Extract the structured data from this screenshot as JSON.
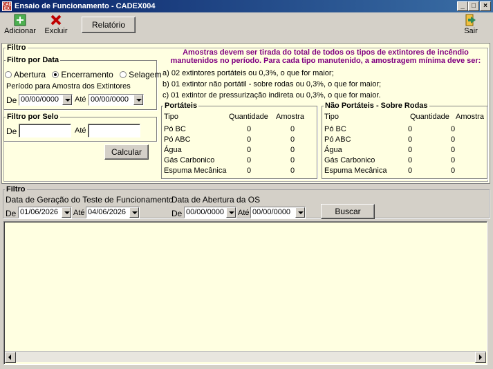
{
  "window": {
    "title": "Ensaio de Funcionamento - CADEX004",
    "app_icon_text": "CAD EX"
  },
  "toolbar": {
    "add_label": "Adicionar",
    "delete_label": "Excluir",
    "report_label": "Relatório",
    "exit_label": "Sair"
  },
  "filter1": {
    "legend": "Filtro",
    "date_filter": {
      "legend": "Filtro por Data",
      "radios": [
        {
          "label": "Abertura",
          "checked": false
        },
        {
          "label": "Encerramento",
          "checked": true
        },
        {
          "label": "Selagem",
          "checked": false
        }
      ],
      "period_label": "Período para Amostra dos Extintores",
      "from_label": "De",
      "from_value": "00/00/0000",
      "to_label": "Até",
      "to_value": "00/00/0000"
    },
    "seal_filter": {
      "legend": "Filtro por Selo",
      "from_label": "De",
      "to_label": "Até",
      "from_value": "",
      "to_value": ""
    },
    "calc_label": "Calcular",
    "notice": "Amostras devem ser tirada do total de todos os tipos de extintores de incêndio manutenidos no período. Para cada tipo manutenido, a amostragem mínima deve ser:",
    "rules": [
      "a) 02 extintores portáteis ou 0,3%, o que for maior;",
      "b) 01 extintor não portátil - sobre rodas ou 0,3%, o que for maior;",
      "c) 01 extintor de pressurização indireta ou 0,3%, o que for maior."
    ],
    "portable": {
      "legend": "Portáteis",
      "headers": [
        "Tipo",
        "Quantidade",
        "Amostra"
      ],
      "rows": [
        {
          "tipo": "Pó BC",
          "qtd": "0",
          "amostra": "0"
        },
        {
          "tipo": "Pó ABC",
          "qtd": "0",
          "amostra": "0"
        },
        {
          "tipo": "Água",
          "qtd": "0",
          "amostra": "0"
        },
        {
          "tipo": "Gás Carbonico",
          "qtd": "0",
          "amostra": "0"
        },
        {
          "tipo": "Espuma Mecânica",
          "qtd": "0",
          "amostra": "0"
        }
      ]
    },
    "nonportable": {
      "legend": "Não Portáteis - Sobre Rodas",
      "headers": [
        "Tipo",
        "Quantidade",
        "Amostra"
      ],
      "rows": [
        {
          "tipo": "Pó BC",
          "qtd": "0",
          "amostra": "0"
        },
        {
          "tipo": "Pó ABC",
          "qtd": "0",
          "amostra": "0"
        },
        {
          "tipo": "Água",
          "qtd": "0",
          "amostra": "0"
        },
        {
          "tipo": "Gás Carbonico",
          "qtd": "0",
          "amostra": "0"
        },
        {
          "tipo": "Espuma Mecânica",
          "qtd": "0",
          "amostra": "0"
        }
      ]
    }
  },
  "filter2": {
    "legend": "Filtro",
    "gen_label": "Data de Geração do Teste de Funcionamento",
    "gen_from_label": "De",
    "gen_from": "01/06/2026",
    "gen_to_label": "Até",
    "gen_to": "04/06/2026",
    "os_label": "Data de Abertura da OS",
    "os_from_label": "De",
    "os_from": "00/00/0000",
    "os_to_label": "Até",
    "os_to": "00/00/0000",
    "search_label": "Buscar"
  },
  "colors": {
    "title_bar": "#0a246a",
    "panel_bg": "#ffffe1",
    "notice": "#800080"
  }
}
